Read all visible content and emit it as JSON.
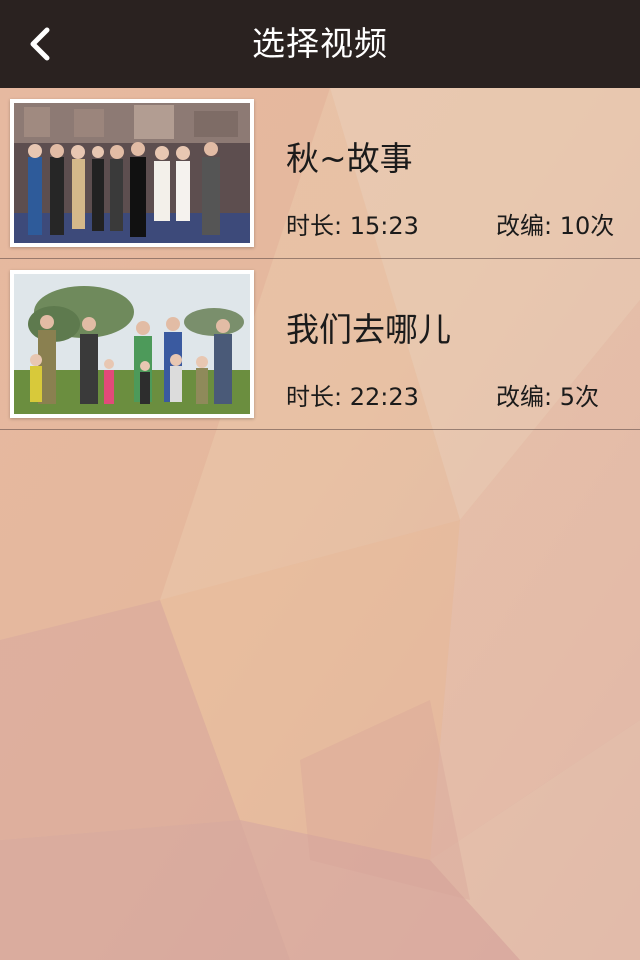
{
  "navbar": {
    "back_icon": "chevron-left-icon",
    "title": "选择视频"
  },
  "videos": [
    {
      "title": "秋~故事",
      "duration_label": "时长:",
      "duration_value": "15:23",
      "adapt_label": "改编:",
      "adapt_value": "10次",
      "thumbnail": "group-photo-on-stage"
    },
    {
      "title": "我们去哪儿",
      "duration_label": "时长:",
      "duration_value": "22:23",
      "adapt_label": "改编:",
      "adapt_value": "5次",
      "thumbnail": "families-outdoors-on-grass"
    }
  ],
  "colors": {
    "navbar_bg": "#2a2220",
    "background_top": "#e8c2a4",
    "background_bottom": "#d9a79f"
  }
}
